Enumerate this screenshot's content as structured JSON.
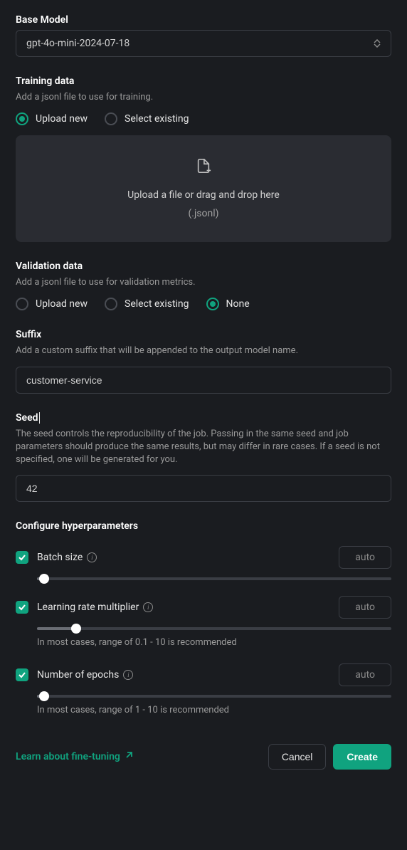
{
  "base_model": {
    "label": "Base Model",
    "value": "gpt-4o-mini-2024-07-18"
  },
  "training_data": {
    "label": "Training data",
    "help": "Add a jsonl file to use for training.",
    "options": {
      "upload": "Upload new",
      "select": "Select existing"
    },
    "selected": "upload",
    "dropzone": {
      "text": "Upload a file or drag and drop here",
      "sub": "(.jsonl)"
    }
  },
  "validation_data": {
    "label": "Validation data",
    "help": "Add a jsonl file to use for validation metrics.",
    "options": {
      "upload": "Upload new",
      "select": "Select existing",
      "none": "None"
    },
    "selected": "none"
  },
  "suffix": {
    "label": "Suffix",
    "help": "Add a custom suffix that will be appended to the output model name.",
    "value": "customer-service"
  },
  "seed": {
    "label": "Seed",
    "help": "The seed controls the reproducibility of the job. Passing in the same seed and job parameters should produce the same results, but may differ in rare cases. If a seed is not specified, one will be generated for you.",
    "value": "42"
  },
  "hyperparams": {
    "label": "Configure hyperparameters",
    "batch_size": {
      "label": "Batch size",
      "value": "auto",
      "slider_pct": 2
    },
    "learning_rate": {
      "label": "Learning rate multiplier",
      "value": "auto",
      "slider_pct": 11,
      "note": "In most cases, range of 0.1 - 10 is recommended"
    },
    "epochs": {
      "label": "Number of epochs",
      "value": "auto",
      "slider_pct": 2,
      "note": "In most cases, range of 1 - 10 is recommended"
    }
  },
  "footer": {
    "learn": "Learn about fine-tuning",
    "cancel": "Cancel",
    "create": "Create"
  }
}
